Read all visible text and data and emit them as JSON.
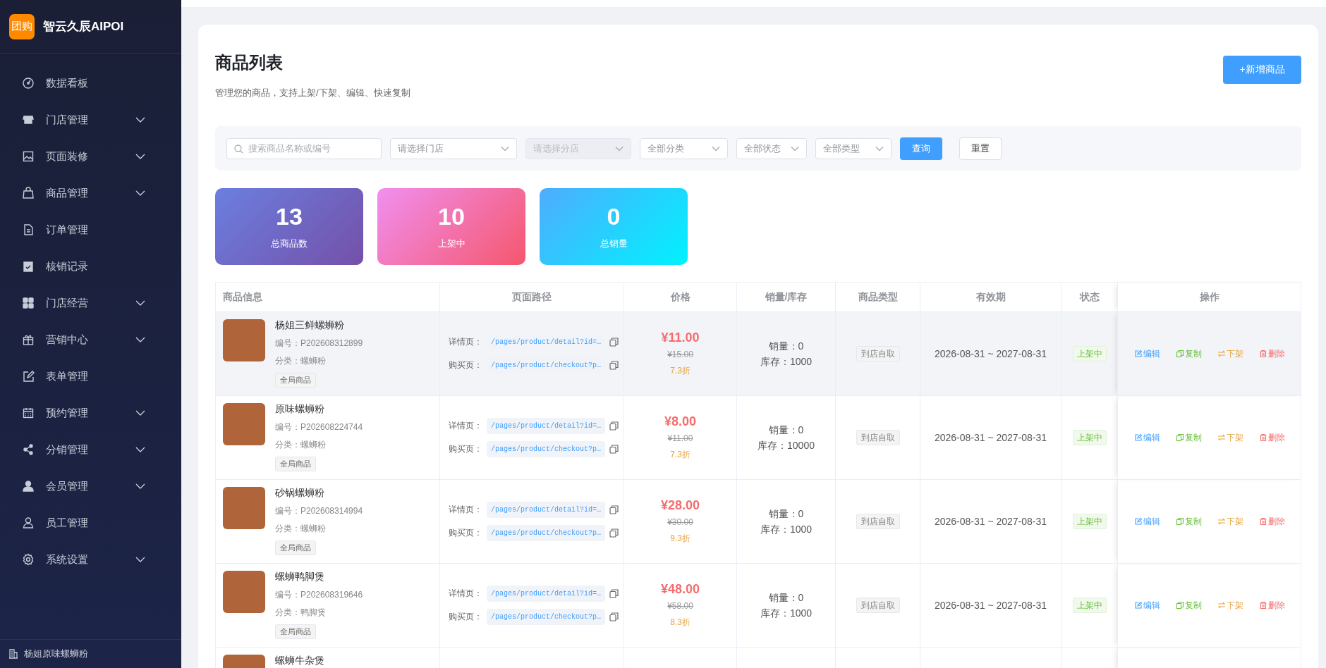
{
  "sidebar": {
    "logo_text": "团购",
    "brand": "智云久辰AIPOI",
    "items": [
      {
        "label": "数据看板",
        "submenu": false
      },
      {
        "label": "门店管理",
        "submenu": true
      },
      {
        "label": "页面装修",
        "submenu": true
      },
      {
        "label": "商品管理",
        "submenu": true
      },
      {
        "label": "订单管理",
        "submenu": false
      },
      {
        "label": "核销记录",
        "submenu": false
      },
      {
        "label": "门店经营",
        "submenu": true
      },
      {
        "label": "营销中心",
        "submenu": true
      },
      {
        "label": "表单管理",
        "submenu": false
      },
      {
        "label": "预约管理",
        "submenu": true
      },
      {
        "label": "分销管理",
        "submenu": true
      },
      {
        "label": "会员管理",
        "submenu": true
      },
      {
        "label": "员工管理",
        "submenu": false
      },
      {
        "label": "系统设置",
        "submenu": true
      }
    ],
    "footer": "杨姐原味螺蛳粉"
  },
  "page": {
    "title": "商品列表",
    "subtitle": "管理您的商品，支持上架/下架、编辑、快速复制",
    "add_button": "+新增商品"
  },
  "filters": {
    "search_placeholder": "搜索商品名称或编号",
    "selects": [
      {
        "placeholder": "请选择门店",
        "disabled": false
      },
      {
        "placeholder": "请选择分店",
        "disabled": true
      },
      {
        "placeholder": "全部分类",
        "disabled": false
      },
      {
        "placeholder": "全部状态",
        "disabled": false
      },
      {
        "placeholder": "全部类型",
        "disabled": false
      }
    ],
    "query_button": "查询",
    "reset_button": "重置"
  },
  "stats": [
    {
      "value": "13",
      "label": "总商品数",
      "kind": "purple"
    },
    {
      "value": "10",
      "label": "上架中",
      "kind": "pink"
    },
    {
      "value": "0",
      "label": "总销量",
      "kind": "cyan"
    }
  ],
  "table": {
    "columns": [
      "商品信息",
      "页面路径",
      "价格",
      "销量/库存",
      "商品类型",
      "有效期",
      "状态",
      "操作"
    ],
    "rows": [
      {
        "hovered": true,
        "name": "杨姐三鲜螺蛳粉",
        "code": "编号：P202608312899",
        "category": "分类：螺蛳粉",
        "tag": "全局商品",
        "paths": [
          {
            "label": "详情页：",
            "value": "/pages/product/detail?id=…"
          },
          {
            "label": "购买页：",
            "value": "/pages/product/checkout?p…"
          }
        ],
        "price": "¥11.00",
        "original_price": "¥15.00",
        "discount": "7.3折",
        "sales": "销量：0",
        "stock": "库存：1000",
        "type": "到店自取",
        "validity": "2026-08-31 ~ 2027-08-31",
        "status": "上架中",
        "actions": [
          {
            "kind": "edit",
            "label": "编辑"
          },
          {
            "kind": "copy",
            "label": "复制"
          },
          {
            "kind": "offline",
            "label": "下架"
          },
          {
            "kind": "delete",
            "label": "删除"
          }
        ]
      },
      {
        "hovered": false,
        "name": "原味螺蛳粉",
        "code": "编号：P202608224744",
        "category": "分类：螺蛳粉",
        "tag": "全局商品",
        "paths": [
          {
            "label": "详情页：",
            "value": "/pages/product/detail?id=…"
          },
          {
            "label": "购买页：",
            "value": "/pages/product/checkout?p…"
          }
        ],
        "price": "¥8.00",
        "original_price": "¥11.00",
        "discount": "7.3折",
        "sales": "销量：0",
        "stock": "库存：10000",
        "type": "到店自取",
        "validity": "2026-08-31 ~ 2027-08-31",
        "status": "上架中",
        "actions": [
          {
            "kind": "edit",
            "label": "编辑"
          },
          {
            "kind": "copy",
            "label": "复制"
          },
          {
            "kind": "offline",
            "label": "下架"
          },
          {
            "kind": "delete",
            "label": "删除"
          }
        ]
      },
      {
        "hovered": false,
        "name": "砂锅螺蛳粉",
        "code": "编号：P202608314994",
        "category": "分类：螺蛳粉",
        "tag": "全局商品",
        "paths": [
          {
            "label": "详情页：",
            "value": "/pages/product/detail?id=…"
          },
          {
            "label": "购买页：",
            "value": "/pages/product/checkout?p…"
          }
        ],
        "price": "¥28.00",
        "original_price": "¥30.00",
        "discount": "9.3折",
        "sales": "销量：0",
        "stock": "库存：1000",
        "type": "到店自取",
        "validity": "2026-08-31 ~ 2027-08-31",
        "status": "上架中",
        "actions": [
          {
            "kind": "edit",
            "label": "编辑"
          },
          {
            "kind": "copy",
            "label": "复制"
          },
          {
            "kind": "offline",
            "label": "下架"
          },
          {
            "kind": "delete",
            "label": "删除"
          }
        ]
      },
      {
        "hovered": false,
        "name": "螺蛳鸭脚煲",
        "code": "编号：P202608319646",
        "category": "分类：鸭脚煲",
        "tag": "全局商品",
        "paths": [
          {
            "label": "详情页：",
            "value": "/pages/product/detail?id=…"
          },
          {
            "label": "购买页：",
            "value": "/pages/product/checkout?p…"
          }
        ],
        "price": "¥48.00",
        "original_price": "¥58.00",
        "discount": "8.3折",
        "sales": "销量：0",
        "stock": "库存：1000",
        "type": "到店自取",
        "validity": "2026-08-31 ~ 2027-08-31",
        "status": "上架中",
        "actions": [
          {
            "kind": "edit",
            "label": "编辑"
          },
          {
            "kind": "copy",
            "label": "复制"
          },
          {
            "kind": "offline",
            "label": "下架"
          },
          {
            "kind": "delete",
            "label": "删除"
          }
        ]
      },
      {
        "hovered": false,
        "name": "螺蛳牛杂煲"
      }
    ]
  }
}
